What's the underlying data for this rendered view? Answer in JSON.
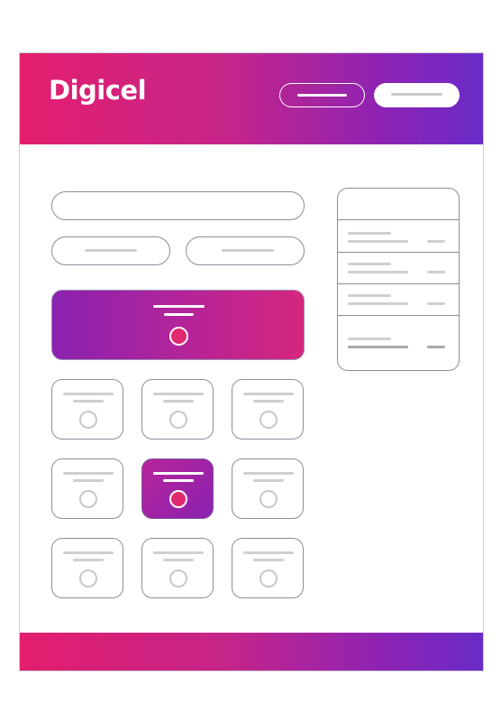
{
  "brand": {
    "name": "Digicel"
  },
  "colors": {
    "gradient_start": "#e31e6e",
    "gradient_mid": "#c5258a",
    "gradient_end": "#6a2bc8",
    "outline": "#8e8c9c",
    "placeholder": "#cfcfd3",
    "highlight_dot": "#e0296f"
  },
  "header": {
    "buttons": [
      {
        "style": "outline",
        "icon": "placeholder-text-bar"
      },
      {
        "style": "solid",
        "icon": "placeholder-text-bar"
      }
    ]
  },
  "form": {
    "fields": [
      {
        "kind": "text-input"
      },
      {
        "kind": "half-input"
      },
      {
        "kind": "half-input"
      }
    ]
  },
  "featured_card": {
    "selected": true,
    "icon": "radio-dot-icon"
  },
  "option_grid": {
    "rows": 3,
    "columns": 3,
    "selected_index": 4
  },
  "summary_panel": {
    "rows": 4,
    "last_row_is_total": true
  },
  "footer": {}
}
